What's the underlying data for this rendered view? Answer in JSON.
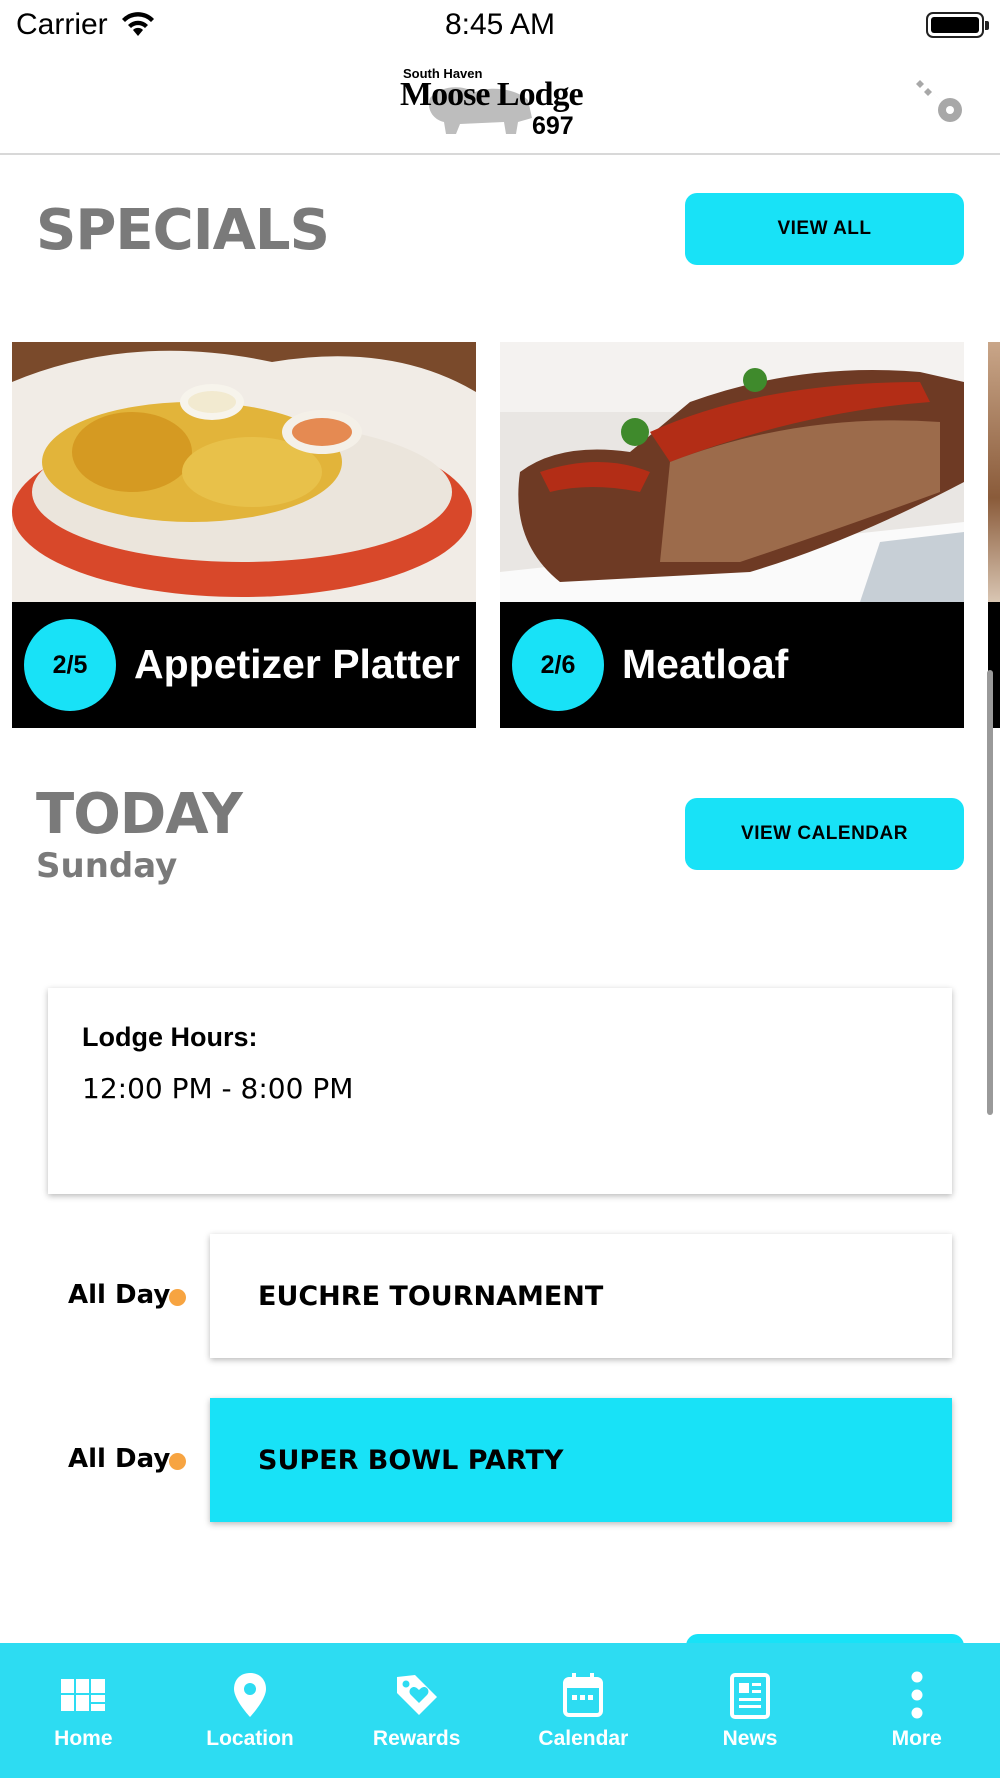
{
  "status_bar": {
    "carrier": "Carrier",
    "time": "8:45 AM"
  },
  "header": {
    "logo_small": "South Haven",
    "logo_main": "Moose Lodge",
    "logo_number": "697"
  },
  "specials": {
    "title": "SPECIALS",
    "view_all_label": "VIEW ALL",
    "items": [
      {
        "date": "2/5",
        "title": "Appetizer Platter"
      },
      {
        "date": "2/6",
        "title": "Meatloaf"
      }
    ]
  },
  "today": {
    "title": "TODAY",
    "day": "Sunday",
    "view_calendar_label": "VIEW CALENDAR",
    "hours_label": "Lodge Hours:",
    "hours_value": "12:00 PM - 8:00 PM",
    "events": [
      {
        "time": "All Day",
        "title": "EUCHRE TOURNAMENT",
        "highlight": false
      },
      {
        "time": "All Day",
        "title": "SUPER BOWL PARTY",
        "highlight": true
      }
    ]
  },
  "tabs": [
    {
      "label": "Home",
      "icon": "home-grid-icon"
    },
    {
      "label": "Location",
      "icon": "location-pin-icon"
    },
    {
      "label": "Rewards",
      "icon": "rewards-tag-icon"
    },
    {
      "label": "Calendar",
      "icon": "calendar-icon"
    },
    {
      "label": "News",
      "icon": "news-icon"
    },
    {
      "label": "More",
      "icon": "more-dots-icon"
    }
  ],
  "colors": {
    "accent": "#18e2f7",
    "tab_bar": "#2ddcf2",
    "event_dot": "#f7a441",
    "section_title": "#7a7a7a"
  }
}
